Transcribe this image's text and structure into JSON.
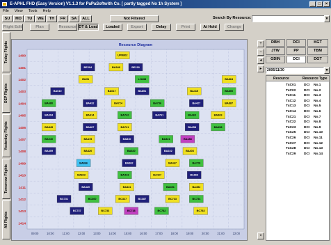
{
  "window": {
    "title": "E-APHL FHD (Easy Version) V1.1.3  for PaPaSoftwith Co. [ partly tagged No 1h System ]"
  },
  "menu": [
    "File",
    "View",
    "Tools",
    "Help"
  ],
  "toolbar_days": [
    "SU",
    "MO",
    "TU",
    "WE",
    "TH",
    "FR",
    "SA",
    "ALL"
  ],
  "filter_button": "Not Filtered",
  "search": {
    "label": "Search By Resource:",
    "value": ""
  },
  "toolbar2": [
    "Flight Edit",
    "Plan",
    "Resource",
    "DT & Load",
    "Loaded",
    "Export",
    "Delay",
    "Print",
    "At Hold",
    "Change"
  ],
  "side_tabs": [
    "Today Flights",
    "DEP Flights",
    "Yesterday Flights",
    "Tomorrow Flights",
    "All Flights"
  ],
  "chart_data": {
    "type": "gantt",
    "title": "Resource Diagram",
    "y_labels": [
      "1400",
      "1401",
      "1402",
      "1403",
      "1404",
      "1405",
      "1406",
      "1407",
      "1408",
      "1409",
      "1410",
      "1411",
      "1412",
      "1413",
      "1414"
    ],
    "x_labels": [
      "09:00",
      "10:00",
      "11:00",
      "12:00",
      "13:00",
      "14:00",
      "15:00",
      "16:00",
      "17:00",
      "18:00",
      "19:00",
      "20:00",
      "21:00",
      "22:00"
    ],
    "bars": [
      {
        "label": "UPR802",
        "x": 0.44,
        "row": 0,
        "color": "#f0e020"
      },
      {
        "label": "BE294",
        "x": 0.28,
        "row": 1,
        "color": "#20207a"
      },
      {
        "label": "BA346",
        "x": 0.41,
        "row": 1,
        "color": "#f0e020"
      },
      {
        "label": "BE218",
        "x": 0.5,
        "row": 1,
        "color": "#20207a"
      },
      {
        "label": "IB451",
        "x": 0.27,
        "row": 2,
        "color": "#f0e020"
      },
      {
        "label": "LH438",
        "x": 0.53,
        "row": 2,
        "color": "#40c040"
      },
      {
        "label": "BA864",
        "x": 0.93,
        "row": 2,
        "color": "#f0e020"
      },
      {
        "label": "BA610",
        "x": 0.14,
        "row": 3,
        "color": "#20207a"
      },
      {
        "label": "BA617",
        "x": 0.39,
        "row": 3,
        "color": "#f0e020"
      },
      {
        "label": "BA851",
        "x": 0.53,
        "row": 3,
        "color": "#20207a"
      },
      {
        "label": "BA415",
        "x": 0.77,
        "row": 3,
        "color": "#f0e020"
      },
      {
        "label": "BA800",
        "x": 0.93,
        "row": 3,
        "color": "#40c040"
      },
      {
        "label": "BA680",
        "x": 0.1,
        "row": 4,
        "color": "#40c040"
      },
      {
        "label": "BA432",
        "x": 0.29,
        "row": 4,
        "color": "#20207a"
      },
      {
        "label": "BA724",
        "x": 0.42,
        "row": 4,
        "color": "#f0e020"
      },
      {
        "label": "BA736",
        "x": 0.6,
        "row": 4,
        "color": "#40c040"
      },
      {
        "label": "BA427",
        "x": 0.78,
        "row": 4,
        "color": "#20207a"
      },
      {
        "label": "BA887",
        "x": 0.93,
        "row": 4,
        "color": "#f0e020"
      },
      {
        "label": "BA094",
        "x": 0.1,
        "row": 5,
        "color": "#20207a"
      },
      {
        "label": "BA414",
        "x": 0.29,
        "row": 5,
        "color": "#f0e020"
      },
      {
        "label": "BA742",
        "x": 0.45,
        "row": 5,
        "color": "#40c040"
      },
      {
        "label": "BA761",
        "x": 0.61,
        "row": 5,
        "color": "#20207a"
      },
      {
        "label": "BA460",
        "x": 0.76,
        "row": 5,
        "color": "#40c040"
      },
      {
        "label": "BA869",
        "x": 0.88,
        "row": 5,
        "color": "#f0e020"
      },
      {
        "label": "BA845",
        "x": 0.1,
        "row": 6,
        "color": "#f0e020"
      },
      {
        "label": "BA467",
        "x": 0.29,
        "row": 6,
        "color": "#20207a"
      },
      {
        "label": "BA721",
        "x": 0.45,
        "row": 6,
        "color": "#f0e020"
      },
      {
        "label": "BA458",
        "x": 0.76,
        "row": 6,
        "color": "#20207a"
      },
      {
        "label": "BA458",
        "x": 0.88,
        "row": 6,
        "color": "#40c040"
      },
      {
        "label": "BA040",
        "x": 0.1,
        "row": 7,
        "color": "#40c040"
      },
      {
        "label": "BA478",
        "x": 0.28,
        "row": 7,
        "color": "#f0e020"
      },
      {
        "label": "BA810",
        "x": 0.46,
        "row": 7,
        "color": "#20207a"
      },
      {
        "label": "BA321",
        "x": 0.64,
        "row": 7,
        "color": "#40c040"
      },
      {
        "label": "BA188",
        "x": 0.74,
        "row": 7,
        "color": "#c040c0"
      },
      {
        "label": "BA409",
        "x": 0.1,
        "row": 8,
        "color": "#20207a"
      },
      {
        "label": "BA420",
        "x": 0.28,
        "row": 8,
        "color": "#f0e020"
      },
      {
        "label": "BA820",
        "x": 0.48,
        "row": 8,
        "color": "#40c040"
      },
      {
        "label": "BA222",
        "x": 0.65,
        "row": 8,
        "color": "#20207a"
      },
      {
        "label": "BA403",
        "x": 0.75,
        "row": 8,
        "color": "#f0e020"
      },
      {
        "label": "BA866",
        "x": 0.26,
        "row": 9,
        "color": "#40c0f0"
      },
      {
        "label": "BA862",
        "x": 0.47,
        "row": 9,
        "color": "#20207a"
      },
      {
        "label": "BA467",
        "x": 0.67,
        "row": 9,
        "color": "#f0e020"
      },
      {
        "label": "BA728",
        "x": 0.78,
        "row": 9,
        "color": "#40c040"
      },
      {
        "label": "BA823",
        "x": 0.25,
        "row": 10,
        "color": "#f0e020"
      },
      {
        "label": "BA413",
        "x": 0.45,
        "row": 10,
        "color": "#40c040"
      },
      {
        "label": "BA427",
        "x": 0.6,
        "row": 10,
        "color": "#f0e020"
      },
      {
        "label": "BA863",
        "x": 0.77,
        "row": 10,
        "color": "#20207a"
      },
      {
        "label": "BA420",
        "x": 0.27,
        "row": 11,
        "color": "#20207a"
      },
      {
        "label": "BA431",
        "x": 0.46,
        "row": 11,
        "color": "#f0e020"
      },
      {
        "label": "BA451",
        "x": 0.66,
        "row": 11,
        "color": "#40c040"
      },
      {
        "label": "BA452",
        "x": 0.78,
        "row": 11,
        "color": "#f0e020"
      },
      {
        "label": "BC731",
        "x": 0.17,
        "row": 12,
        "color": "#20207a"
      },
      {
        "label": "BC360",
        "x": 0.3,
        "row": 12,
        "color": "#40c040"
      },
      {
        "label": "BC327",
        "x": 0.44,
        "row": 12,
        "color": "#f0e020"
      },
      {
        "label": "BC387",
        "x": 0.53,
        "row": 12,
        "color": "#20207a"
      },
      {
        "label": "BC733",
        "x": 0.67,
        "row": 12,
        "color": "#f0e020"
      },
      {
        "label": "BC734",
        "x": 0.78,
        "row": 12,
        "color": "#40c040"
      },
      {
        "label": "BC737",
        "x": 0.23,
        "row": 13,
        "color": "#20207a"
      },
      {
        "label": "BC733",
        "x": 0.36,
        "row": 13,
        "color": "#f0e020"
      },
      {
        "label": "BC738",
        "x": 0.48,
        "row": 13,
        "color": "#c040c0"
      },
      {
        "label": "BC782",
        "x": 0.62,
        "row": 13,
        "color": "#40c040"
      },
      {
        "label": "BC783",
        "x": 0.8,
        "row": 13,
        "color": "#f0e020"
      }
    ]
  },
  "right_panel": {
    "grid": [
      [
        "DBH",
        "DCI",
        "KGT"
      ],
      [
        "JTW",
        "PP",
        "TBM"
      ],
      [
        "GDIN",
        "DCI",
        "DGT"
      ]
    ],
    "date_field": "2005/11/30",
    "table_headers": [
      "Resource",
      "Resource Type"
    ],
    "table_rows": [
      [
        "T4C01",
        "DCI",
        "No.1"
      ],
      [
        "T4C02",
        "DCI",
        "No.2"
      ],
      [
        "T4C11",
        "DCI",
        "No.3"
      ],
      [
        "T4C12",
        "DCI",
        "No.4"
      ],
      [
        "T4C13",
        "DCI",
        "No.5"
      ],
      [
        "T4C14",
        "DCI",
        "No.6"
      ],
      [
        "T4C21",
        "DCI",
        "No.7"
      ],
      [
        "T4C22",
        "DCI",
        "No.8"
      ],
      [
        "T4C23",
        "DCI",
        "No.9"
      ],
      [
        "T4C25",
        "DCI",
        "No.10"
      ],
      [
        "T4C26",
        "DCI",
        "No.11"
      ],
      [
        "T4C27",
        "DCI",
        "No.12"
      ],
      [
        "T4C28",
        "DCI",
        "No.13"
      ],
      [
        "T4C29",
        "DCI",
        "No.14"
      ]
    ]
  }
}
